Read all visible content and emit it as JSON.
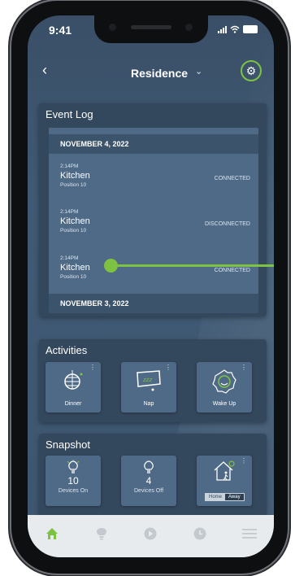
{
  "status": {
    "time": "9:41"
  },
  "header": {
    "title": "Residence"
  },
  "event_log": {
    "title": "Event Log",
    "groups": [
      {
        "date": "NOVEMBER 4, 2022",
        "events": [
          {
            "time": "2:14PM",
            "room": "Kitchen",
            "position": "Position 10",
            "state": "CONNECTED"
          },
          {
            "time": "2:14PM",
            "room": "Kitchen",
            "position": "Position 10",
            "state": "DISCONNECTED"
          },
          {
            "time": "2:14PM",
            "room": "Kitchen",
            "position": "Position 10",
            "state": "CONNECTED"
          }
        ]
      },
      {
        "date": "NOVEMBER 3, 2022",
        "events": []
      }
    ]
  },
  "activities": {
    "title": "Activities",
    "items": [
      {
        "label": "Dinner",
        "icon": "disco-ball-icon"
      },
      {
        "label": "Nap",
        "icon": "sleep-icon"
      },
      {
        "label": "Wake Up",
        "icon": "sunrise-icon"
      }
    ]
  },
  "snapshot": {
    "title": "Snapshot",
    "devices_on": {
      "count": "10",
      "label": "Devices On"
    },
    "devices_off": {
      "count": "4",
      "label": "Devices Off"
    },
    "mode": {
      "home": "Home",
      "away": "Away",
      "selected": "Away"
    }
  },
  "nav": {
    "items": [
      "home-icon",
      "lightbulb-icon",
      "play-icon",
      "clock-icon",
      "menu-icon"
    ],
    "active": "home-icon"
  },
  "colors": {
    "accent": "#7ec242",
    "card": "#33475d",
    "tile": "#4f6a86"
  }
}
